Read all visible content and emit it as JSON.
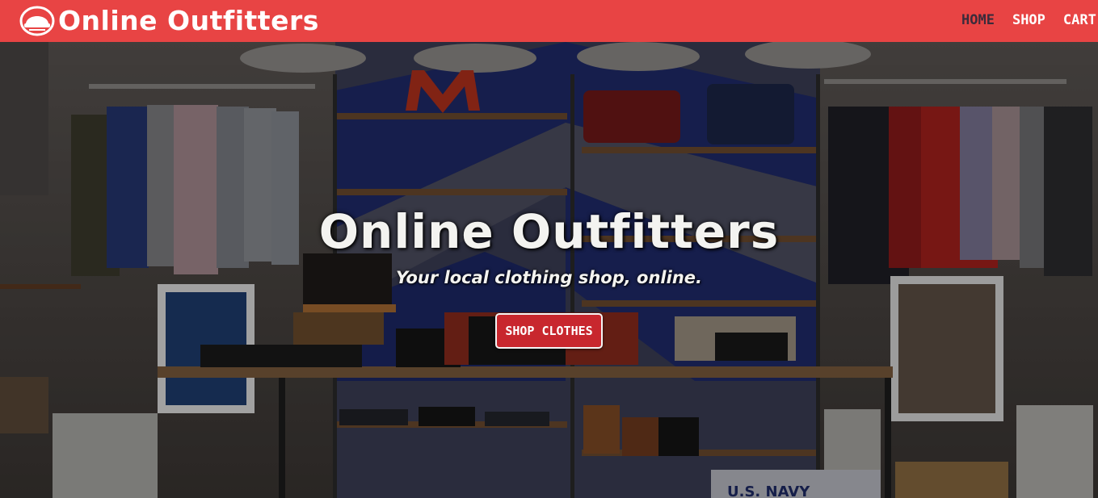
{
  "navbar": {
    "brand": "Online Outfitters",
    "links": [
      {
        "label": "HOME",
        "active": true
      },
      {
        "label": "SHOP",
        "active": false
      },
      {
        "label": "CART",
        "active": false
      }
    ]
  },
  "hero": {
    "title": "Online Outfitters",
    "tagline": "Your local clothing shop, online.",
    "cta_label": "SHOP CLOTHES",
    "background_text": "U.S. NAVY"
  },
  "colors": {
    "navbar": "#e84444",
    "active_link": "#3b2b3b",
    "cta": "#c8272e",
    "text_light": "#f3f3f0"
  },
  "icons": {
    "logo": "hat-logo-icon"
  }
}
